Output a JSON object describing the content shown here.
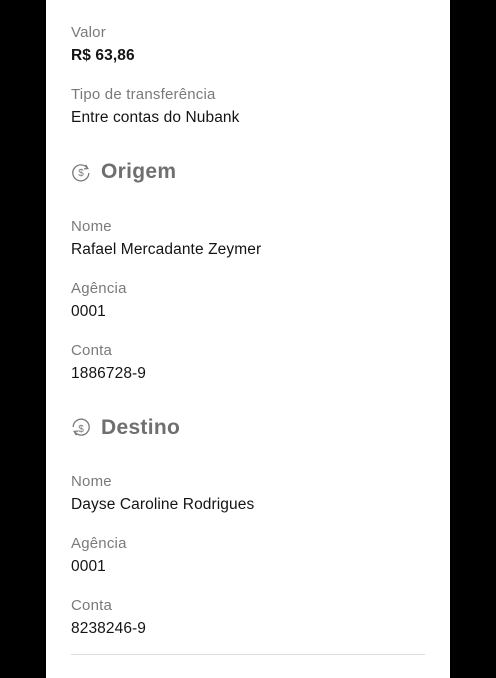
{
  "summary": {
    "valor_label": "Valor",
    "valor_value": "R$ 63,86",
    "tipo_label": "Tipo de transferência",
    "tipo_value": "Entre contas do Nubank"
  },
  "origem": {
    "title": "Origem",
    "icon": "money-transfer-icon",
    "nome_label": "Nome",
    "nome_value": "Rafael Mercadante Zeymer",
    "agencia_label": "Agência",
    "agencia_value": "0001",
    "conta_label": "Conta",
    "conta_value": "1886728-9"
  },
  "destino": {
    "title": "Destino",
    "icon": "money-transfer-icon",
    "nome_label": "Nome",
    "nome_value": "Dayse Caroline Rodrigues",
    "agencia_label": "Agência",
    "agencia_value": "0001",
    "conta_label": "Conta",
    "conta_value": "8238246-9"
  },
  "colors": {
    "background": "#ffffff",
    "label": "#7a7a7a",
    "value": "#141414",
    "section_title": "#6f6f6f",
    "frame": "#000000"
  }
}
